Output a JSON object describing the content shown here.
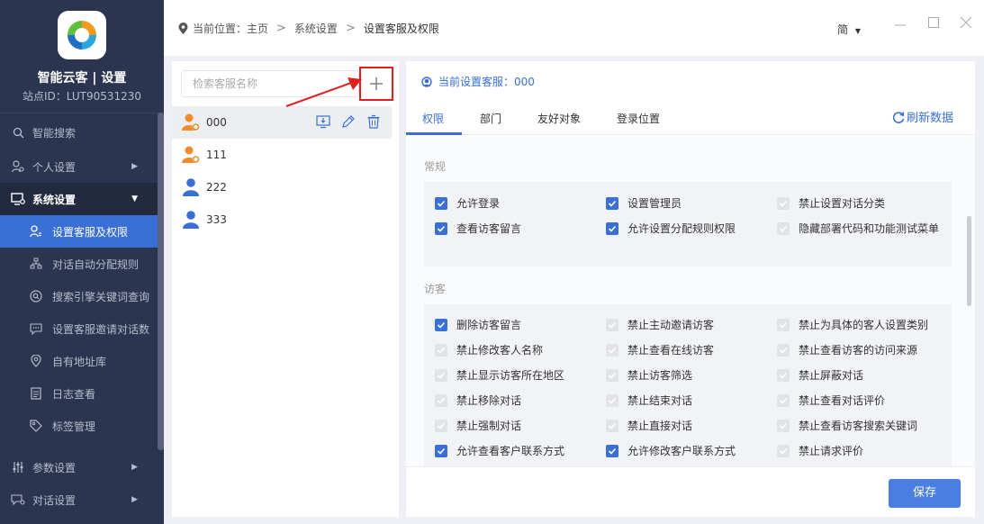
{
  "sidebar": {
    "brand": "智能云客 | 设置",
    "site_id": "站点ID：LUT90531230",
    "items": [
      {
        "label": "智能搜索"
      },
      {
        "label": "个人设置"
      },
      {
        "label": "系统设置"
      },
      {
        "label": "设置客服及权限"
      },
      {
        "label": "对话自动分配规则"
      },
      {
        "label": "搜索引擎关键词查询"
      },
      {
        "label": "设置客服邀请对话数"
      },
      {
        "label": "自有地址库"
      },
      {
        "label": "日志查看"
      },
      {
        "label": "标签管理"
      },
      {
        "label": "参数设置"
      },
      {
        "label": "对话设置"
      }
    ]
  },
  "topbar": {
    "crumb_prefix": "当前位置：主页",
    "crumb_mid": "系统设置",
    "crumb_current": "设置客服及权限",
    "lang": "简"
  },
  "list": {
    "search_placeholder": "检索客服名称",
    "agents": [
      {
        "name": "000"
      },
      {
        "name": "111"
      },
      {
        "name": "222"
      },
      {
        "name": "333"
      }
    ]
  },
  "main": {
    "current_cs": "当前设置客服：000",
    "tabs": [
      "权限",
      "部门",
      "友好对象",
      "登录位置"
    ],
    "refresh": "刷新数据",
    "sections": [
      {
        "title": "常规",
        "options": [
          {
            "label": "允许登录",
            "checked": true
          },
          {
            "label": "设置管理员",
            "checked": true
          },
          {
            "label": "禁止设置对话分类",
            "checked": false
          },
          {
            "label": "查看访客留言",
            "checked": true
          },
          {
            "label": "允许设置分配规则权限",
            "checked": true
          },
          {
            "label": "隐藏部署代码和功能测试菜单",
            "checked": false
          }
        ]
      },
      {
        "title": "访客",
        "options": [
          {
            "label": "删除访客留言",
            "checked": true
          },
          {
            "label": "禁止主动邀请访客",
            "checked": false
          },
          {
            "label": "禁止为具体的客人设置类别",
            "checked": false
          },
          {
            "label": "禁止修改客人名称",
            "checked": false
          },
          {
            "label": "禁止查看在线访客",
            "checked": false
          },
          {
            "label": "禁止查看访客的访问来源",
            "checked": false
          },
          {
            "label": "禁止显示访客所在地区",
            "checked": false
          },
          {
            "label": "禁止访客筛选",
            "checked": false
          },
          {
            "label": "禁止屏蔽对话",
            "checked": false
          },
          {
            "label": "禁止移除对话",
            "checked": false
          },
          {
            "label": "禁止结束对话",
            "checked": false
          },
          {
            "label": "禁止查看对话评价",
            "checked": false
          },
          {
            "label": "禁止强制对话",
            "checked": false
          },
          {
            "label": "禁止直接对话",
            "checked": false
          },
          {
            "label": "禁止查看访客搜索关键词",
            "checked": false
          },
          {
            "label": "允许查看客户联系方式",
            "checked": true
          },
          {
            "label": "允许修改客户联系方式",
            "checked": true
          },
          {
            "label": "禁止请求评价",
            "checked": false
          }
        ]
      }
    ],
    "save": "保存"
  },
  "colors": {
    "sidebar_bg": "#2c3550",
    "accent": "#3a6fd6",
    "annotation": "#e02020"
  }
}
